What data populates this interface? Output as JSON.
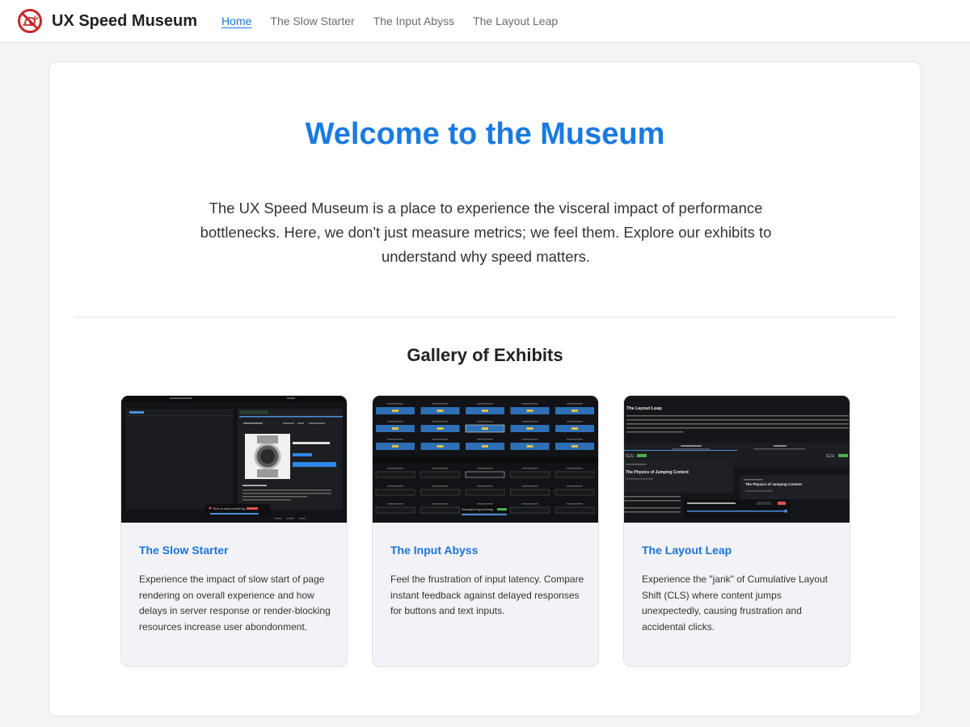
{
  "app": {
    "name": "UX Speed Museum",
    "logo_icon": "no-slow-snail-icon",
    "accent": "#1a7ae0",
    "danger": "#c62828"
  },
  "nav": {
    "items": [
      {
        "label": "Home",
        "active": true
      },
      {
        "label": "The Slow Starter",
        "active": false
      },
      {
        "label": "The Input Abyss",
        "active": false
      },
      {
        "label": "The Layout Leap",
        "active": false
      }
    ]
  },
  "hero": {
    "title": "Welcome to the Museum",
    "intro": "The UX Speed Museum is a place to experience the visceral impact of performance bottlenecks. Here, we don't just measure metrics; we feel them. Explore our exhibits to understand why speed matters."
  },
  "gallery": {
    "title": "Gallery of Exhibits",
    "exhibits": [
      {
        "title": "The Slow Starter",
        "description": "Experience the impact of slow start of page rendering on overall experience and how delays in server response or render-blocking resources increase user abondonment.",
        "thumb": {
          "caption": "Time to start rendering"
        }
      },
      {
        "title": "The Input Abyss",
        "description": "Feel the frustration of input latency. Compare instant feedback against delayed responses for buttons and text inputs.",
        "thumb": {
          "caption": "Simulated Input Delay"
        }
      },
      {
        "title": "The Layout Leap",
        "description": "Experience the \"jank\" of Cumulative Layout Shift (CLS) where content jumps unexpectedly, causing frustration and accidental clicks.",
        "thumb": {
          "heading": "The Layout Leap",
          "card_title_left": "The Physics of Jumping Content",
          "card_title_right": "The Physics of Jumping Content",
          "metric_label": "CLS:"
        }
      }
    ]
  }
}
